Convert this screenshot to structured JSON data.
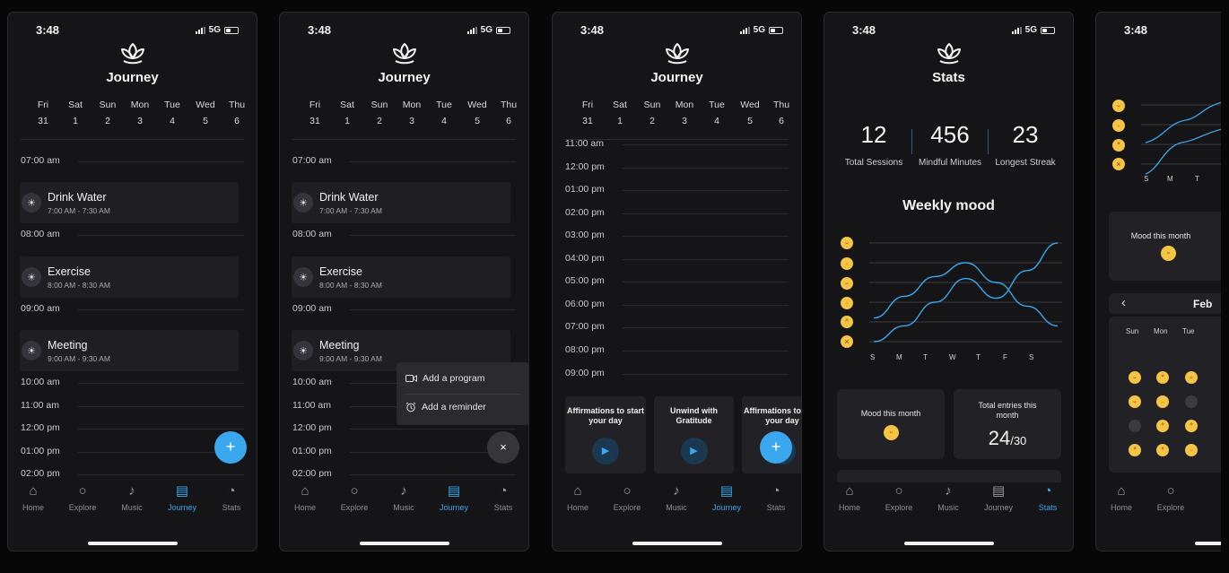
{
  "status": {
    "time": "3:48",
    "network": "5G"
  },
  "journey_title": "Journey",
  "stats_title": "Stats",
  "days": [
    {
      "name": "Fri",
      "date": "31"
    },
    {
      "name": "Sat",
      "date": "1"
    },
    {
      "name": "Sun",
      "date": "2"
    },
    {
      "name": "Mon",
      "date": "3"
    },
    {
      "name": "Tue",
      "date": "4"
    },
    {
      "name": "Wed",
      "date": "5"
    },
    {
      "name": "Thu",
      "date": "6"
    }
  ],
  "times": {
    "t0700": "07:00 am",
    "t0800": "08:00 am",
    "t0900": "09:00 am",
    "t1000": "10:00 am",
    "t1100": "11:00 am",
    "t1200": "12:00 pm",
    "t0100": "01:00 pm",
    "t0200": "02:00 pm",
    "t0300": "03:00 pm",
    "t0400": "04:00 pm",
    "t0500": "05:00 pm",
    "t0600": "06:00 pm",
    "t0700p": "07:00 pm",
    "t0800p": "08:00 pm",
    "t0900p": "09:00 pm"
  },
  "events": [
    {
      "title": "Drink Water",
      "time": "7:00 AM - 7:30 AM"
    },
    {
      "title": "Exercise",
      "time": "8:00 AM - 8:30 AM"
    },
    {
      "title": "Meeting",
      "time": "9:00 AM - 9:30 AM"
    }
  ],
  "fab": {
    "plus": "+",
    "close": "×"
  },
  "popup": {
    "add_program": "Add a program",
    "add_reminder": "Add a reminder"
  },
  "programs": [
    {
      "title": "Affirmations to start your day"
    },
    {
      "title": "Unwind with Gratitude"
    },
    {
      "title": "Affirmations to start your day"
    }
  ],
  "tabs": {
    "home": "Home",
    "explore": "Explore",
    "music": "Music",
    "journey": "Journey",
    "stats": "Stats"
  },
  "stats": {
    "sessions_value": "12",
    "sessions_label": "Total Sessions",
    "minutes_value": "456",
    "minutes_label": "Mindful Minutes",
    "streak_value": "23",
    "streak_label": "Longest Streak",
    "weekly_mood": "Weekly mood",
    "mood_month": "Mood this month",
    "total_entries_label": "Total entries this month",
    "total_entries_value": "24",
    "total_entries_of": "/30"
  },
  "chart_data": {
    "type": "line",
    "title": "Weekly mood",
    "categories": [
      "S",
      "M",
      "T",
      "W",
      "T",
      "F",
      "S"
    ],
    "y_scale": "mood emoji, 1 (lowest) to 6 (highest)",
    "series": [
      {
        "values": [
          2.2,
          3.3,
          4.3,
          5.0,
          4.0,
          2.8,
          1.8
        ]
      },
      {
        "values": [
          1.0,
          1.8,
          3.0,
          4.2,
          3.2,
          4.6,
          6.0
        ]
      }
    ],
    "colors": [
      "#3aa7ee",
      "#3aa7ee"
    ]
  },
  "calendar": {
    "month": "Feb",
    "prev": "‹",
    "weekdays": {
      "sun": "Sun",
      "mon": "Mon",
      "tue": "Tue"
    }
  },
  "mini_axis": {
    "s": "S",
    "m": "M",
    "t": "T"
  },
  "icons": [
    "lotus-icon",
    "sun-icon",
    "play-icon",
    "video-icon",
    "alarm-icon",
    "home-icon",
    "search-icon",
    "music-note-icon",
    "journal-icon",
    "pie-chart-icon",
    "chevron-left-icon"
  ],
  "accent": "#3aa7ee"
}
